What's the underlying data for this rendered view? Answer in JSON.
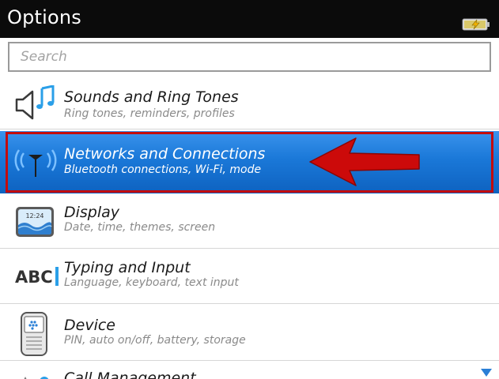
{
  "header": {
    "title": "Options"
  },
  "search": {
    "placeholder": "Search"
  },
  "items": [
    {
      "title": "Sounds and Ring Tones",
      "subtitle": "Ring tones, reminders, profiles",
      "icon": "speaker-music-icon"
    },
    {
      "title": "Networks and Connections",
      "subtitle": "Bluetooth connections, Wi-Fi, mode",
      "icon": "antenna-icon",
      "selected": true
    },
    {
      "title": "Display",
      "subtitle": "Date, time, themes, screen",
      "icon": "display-icon",
      "icon_text": "12:24"
    },
    {
      "title": "Typing and Input",
      "subtitle": "Language, keyboard, text input",
      "icon": "abc-icon",
      "icon_text": "ABC"
    },
    {
      "title": "Device",
      "subtitle": "PIN, auto on/off, battery, storage",
      "icon": "device-icon"
    },
    {
      "title": "Call Management",
      "icon": "call-management-icon"
    }
  ],
  "colors": {
    "selected": "#1a78d8",
    "highlight_border": "#c30b0b",
    "arrow": "#cc0a0a"
  }
}
